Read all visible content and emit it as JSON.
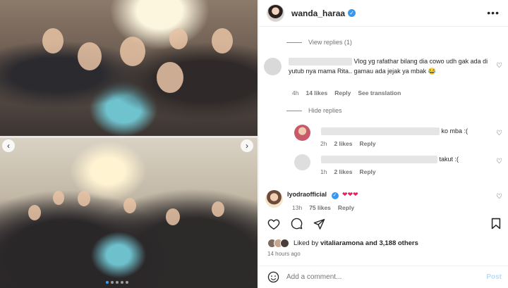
{
  "post": {
    "username": "wanda_haraa",
    "more_icon": "more-horizontal-icon"
  },
  "view_replies": "View replies (1)",
  "comments": [
    {
      "text": "Vlog yg rafathar bilang dia cowo udh gak ada di yutub nya mama Rita.. gamau ada jejak ya mbak 😂",
      "time": "4h",
      "likes": "14 likes",
      "reply": "Reply",
      "translation": "See translation"
    }
  ],
  "hide_replies": "Hide replies",
  "replies": [
    {
      "text": "ko mba :(",
      "time": "2h",
      "likes": "2 likes",
      "reply": "Reply"
    },
    {
      "text": "takut :(",
      "time": "1h",
      "likes": "2 likes",
      "reply": "Reply"
    }
  ],
  "verified_comment": {
    "username": "lyodraofficial",
    "text": "❤❤❤",
    "time": "13h",
    "likes": "75 likes",
    "reply": "Reply"
  },
  "liked_by": {
    "prefix": "Liked by",
    "user": "vitaliaramona",
    "suffix": "and 3,188 others"
  },
  "time_ago": "14 hours ago",
  "add_comment_placeholder": "Add a comment...",
  "post_button": "Post",
  "colors": {
    "accent": "#3897f0",
    "post_disabled": "#b2dffc"
  }
}
